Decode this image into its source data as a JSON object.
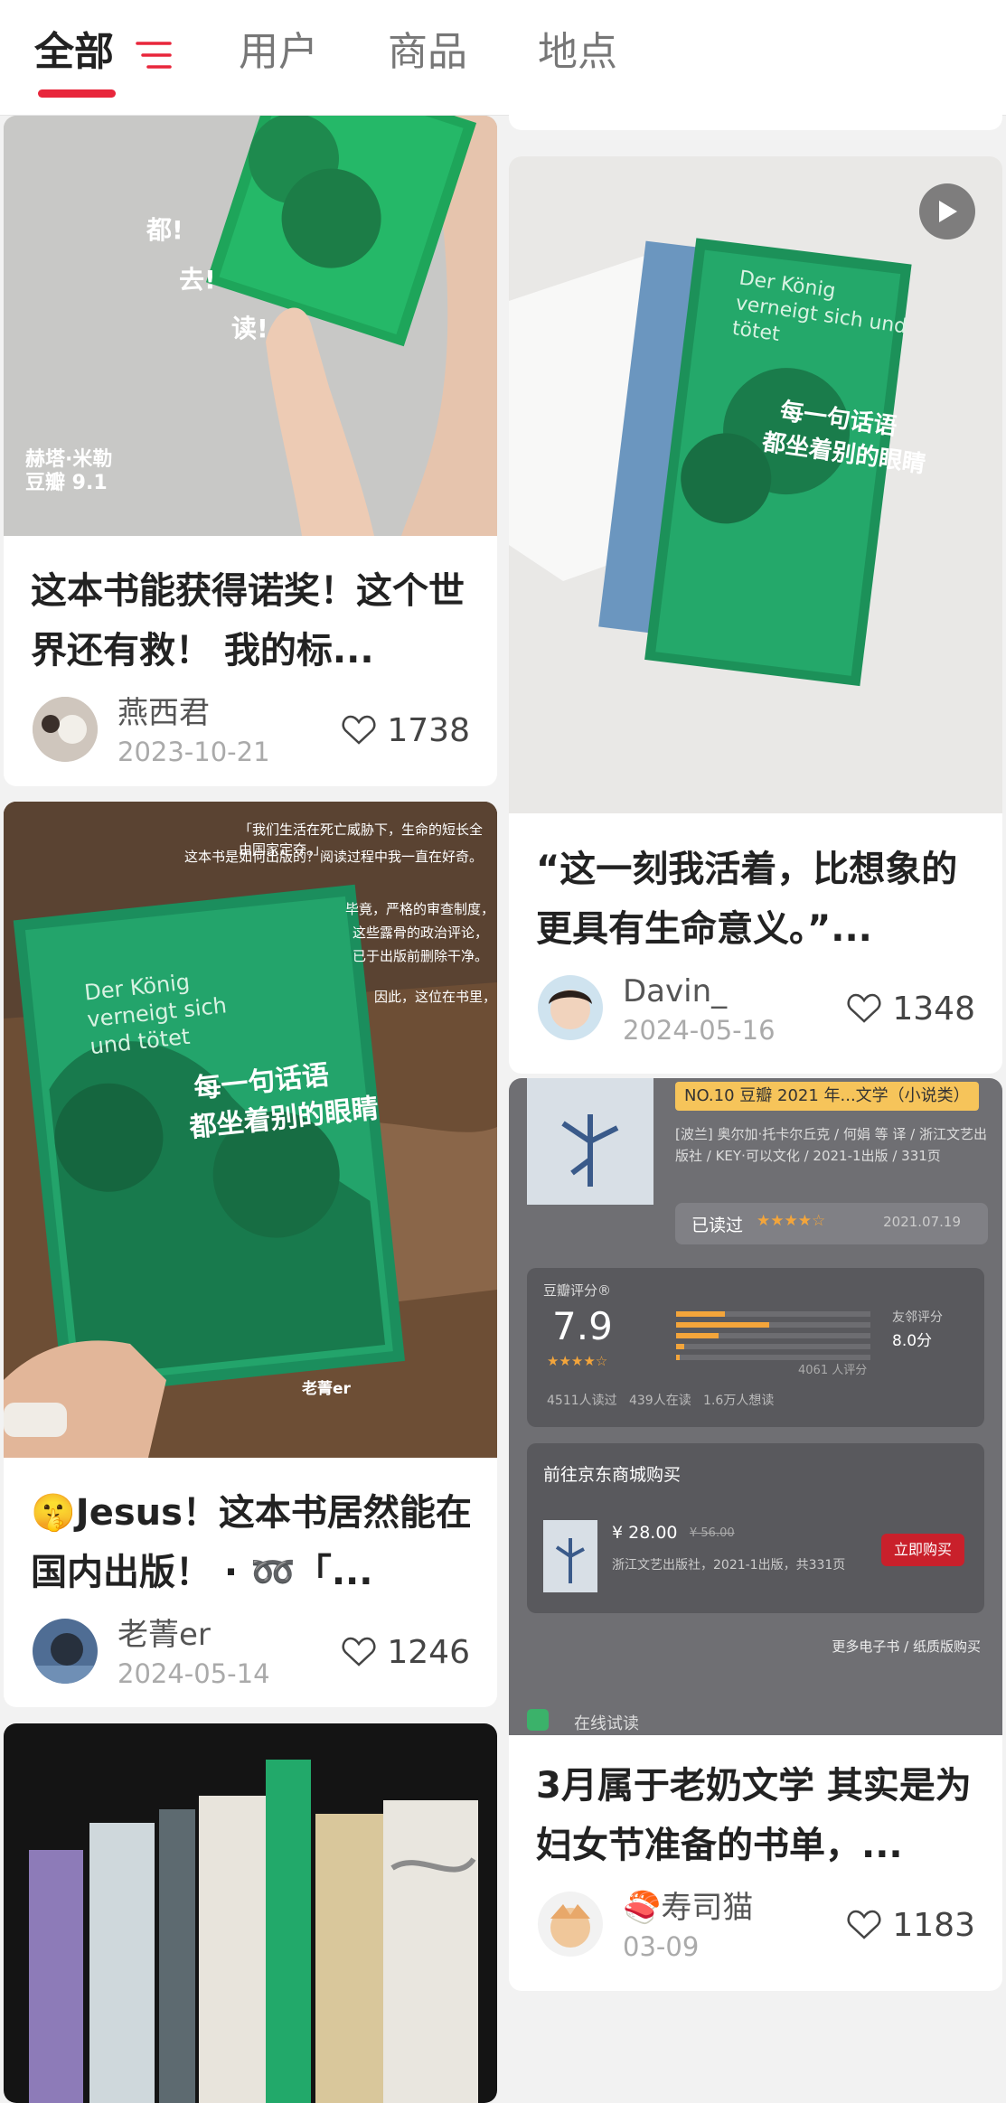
{
  "tabs": [
    {
      "label": "全部",
      "active": true
    },
    {
      "label": "用户",
      "active": false
    },
    {
      "label": "商品",
      "active": false
    },
    {
      "label": "地点",
      "active": false
    }
  ],
  "accent_color": "#e8263b",
  "icons": {
    "filter": "filter-icon",
    "like": "heart-outline-icon",
    "play": "play-icon"
  },
  "cards": [
    {
      "title": "这本书能获得诺奖！这个世界还有救！ 我的标...",
      "author": "燕西君",
      "date": "2023-10-21",
      "likes": "1738",
      "image_text": {
        "l1": "都!",
        "l2": "去!",
        "l3": "读!",
        "caption1": "赫塔·米勒",
        "caption2": "豆瓣 9.1"
      }
    },
    {
      "title": "🤫Jesus！这本书居然能在国内出版！ · ➿「...",
      "author": "老菁er",
      "date": "2024-05-14",
      "likes": "1246",
      "image_text": {
        "quote1": "「我们生活在死亡威胁下，生命的短长全由国家定夺。」",
        "quote2": "这本书是如何出版的？阅读过程中我一直在好奇。",
        "quote3": "毕竟，严格的审查制度，",
        "quote4": "这些露骨的政治评论，",
        "quote5": "已于出版前删除干净。",
        "quote6": "因此，这位在书里，",
        "book_de": "Der König verneigt sich und tötet",
        "book_cn1": "每一句话语",
        "book_cn2": "都坐着别的眼睛",
        "watermark": "老菁er"
      }
    },
    {
      "title": "“这一刻我活着，比想象的更具有生命意义。”...",
      "author": "Davin_",
      "date": "2024-05-16",
      "likes": "1348",
      "image_text": {
        "book_de": "Der König verneigt sich und tötet",
        "book_cn1": "每一句话语",
        "book_cn2": "都坐着别的眼睛"
      }
    },
    {
      "title": "3月属于老奶文学 其实是为妇女节准备的书单，...",
      "author": "🍣寿司猫",
      "date": "03-09",
      "likes": "1183",
      "image_text": {
        "rank": "NO.10",
        "rank_label": "豆瓣 2021 年...文学（小说类）",
        "meta": "[波兰] 奥尔加·托卡尔丘克 / 何娟 等 译 / 浙江文艺出版社 / KEY·可以文化 / 2021-1出版 / 331页",
        "read_label": "已读过",
        "read_date": "2021.07.19",
        "score_title": "豆瓣评分®",
        "score": "7.9",
        "friend_label": "友邻评分",
        "friend_score": "8.0分",
        "rating_count": "4061 人评分",
        "stats": "4511人读过   439人在读   1.6万人想读",
        "jd_title": "前往京东商城购买",
        "price": "¥ 28.00",
        "old_price": "¥ 56.00",
        "publisher": "浙江文艺出版社，2021-1出版，共331页",
        "buy_label": "立即购买",
        "more_label": "更多电子书 / 纸质版购买",
        "trial_label": "在线试读"
      }
    },
    {
      "title": "",
      "author": "",
      "date": "",
      "likes": "",
      "image_text": {}
    }
  ]
}
